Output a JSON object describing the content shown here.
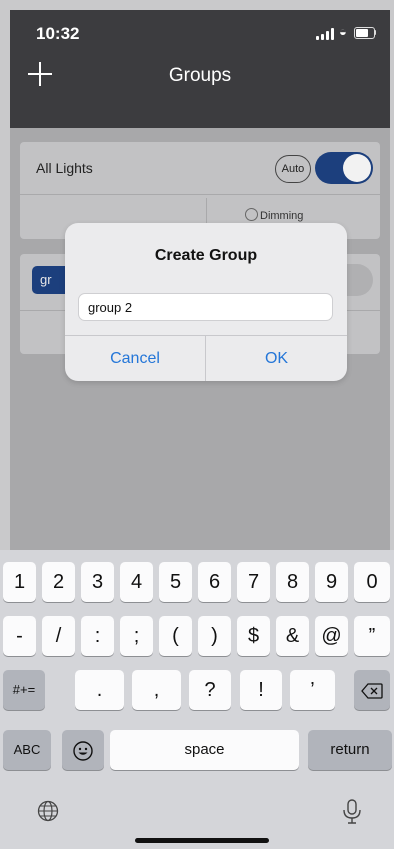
{
  "status_bar": {
    "time": "10:32"
  },
  "nav": {
    "title": "Groups",
    "add_icon": "plus-icon"
  },
  "cards": [
    {
      "label": "All Lights",
      "auto_label": "Auto",
      "toggle_on": true,
      "dimming_label": "Dimming"
    },
    {
      "group_chip": "gr",
      "toggle_on": false
    }
  ],
  "dialog": {
    "title": "Create Group",
    "input_value": "group 2",
    "cancel_label": "Cancel",
    "ok_label": "OK",
    "accent_color": "#2476d8"
  },
  "keyboard": {
    "row1": [
      "1",
      "2",
      "3",
      "4",
      "5",
      "6",
      "7",
      "8",
      "9",
      "0"
    ],
    "row2": [
      "-",
      "/",
      ":",
      ";",
      "(",
      ")",
      "$",
      "&",
      "@",
      "”"
    ],
    "row3": {
      "switch": "#+=",
      "keys": [
        ".",
        ",",
        "?",
        "!",
        "’"
      ]
    },
    "row4": {
      "abc": "ABC",
      "space": "space",
      "return": "return"
    }
  },
  "colors": {
    "toggle_on": "#1c3f7d",
    "nav_bg": "#3c3c3f"
  }
}
